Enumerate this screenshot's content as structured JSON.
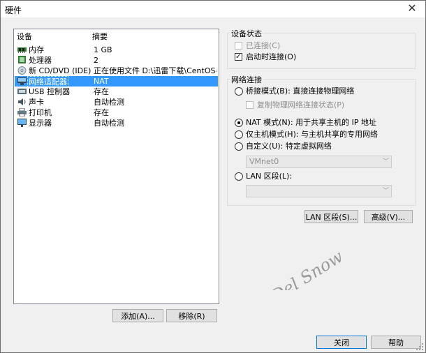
{
  "window": {
    "title": "硬件"
  },
  "devices": {
    "headers": {
      "device": "设备",
      "summary": "摘要"
    },
    "items": [
      {
        "name": "内存",
        "summary": "1 GB",
        "icon": "memory-icon"
      },
      {
        "name": "处理器",
        "summary": "2",
        "icon": "processor-icon"
      },
      {
        "name": "新 CD/DVD (IDE)",
        "summary": "正在使用文件 D:\\迅雷下载\\CentOS-...",
        "icon": "cdrom-icon"
      },
      {
        "name": "网络适配器",
        "summary": "NAT",
        "icon": "network-adapter-icon",
        "selected": true
      },
      {
        "name": "USB 控制器",
        "summary": "存在",
        "icon": "usb-icon"
      },
      {
        "name": "声卡",
        "summary": "自动检测",
        "icon": "sound-icon"
      },
      {
        "name": "打印机",
        "summary": "存在",
        "icon": "printer-icon"
      },
      {
        "name": "显示器",
        "summary": "自动检测",
        "icon": "display-icon"
      }
    ],
    "add_label": "添加(A)...",
    "remove_label": "移除(R)"
  },
  "device_status": {
    "title": "设备状态",
    "connected": {
      "label": "已连接(C)",
      "checked": false,
      "enabled": false
    },
    "connect_at_power_on": {
      "label": "启动时连接(O)",
      "checked": true
    }
  },
  "network": {
    "title": "网络连接",
    "bridged": "桥接模式(B): 直接连接物理网络",
    "replicate": "复制物理网络连接状态(P)",
    "nat": "NAT 模式(N): 用于共享主机的 IP 地址",
    "host_only": "仅主机模式(H): 与主机共享的专用网络",
    "custom": "自定义(U): 特定虚拟网络",
    "vmnet_value": "VMnet0",
    "lan": "LAN 区段(L):",
    "lan_value": "",
    "selected_mode": "nat"
  },
  "buttons": {
    "lan_segments": "LAN 区段(S)...",
    "advanced": "高级(V)...",
    "close": "关闭",
    "help": "帮助"
  },
  "watermark": {
    "text": "Del Snow"
  }
}
